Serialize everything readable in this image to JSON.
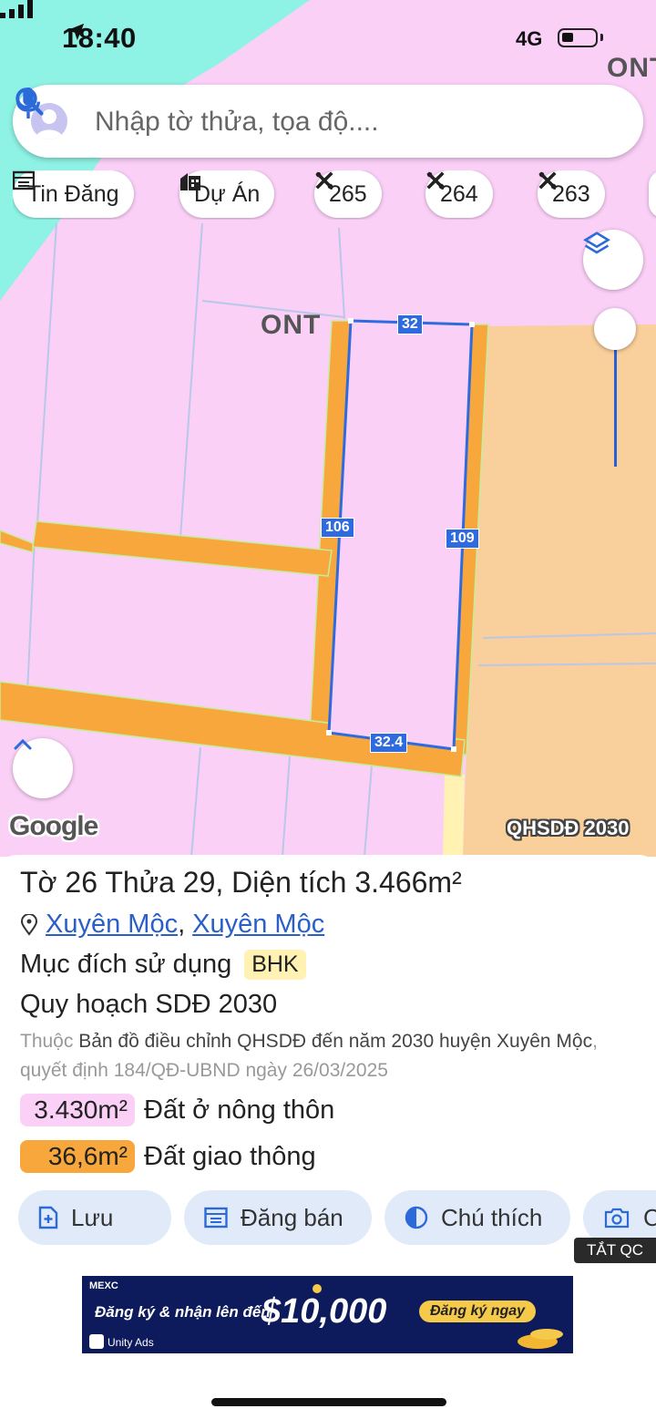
{
  "status": {
    "time": "18:40",
    "network": "4G"
  },
  "search": {
    "placeholder": "Nhập tờ thửa, tọa độ...."
  },
  "chips": [
    {
      "label": "Tin Đăng",
      "icon": "listing-icon"
    },
    {
      "label": "Dự Án",
      "icon": "building-icon"
    },
    {
      "label": "265",
      "icon": "tools-icon"
    },
    {
      "label": "264",
      "icon": "tools-icon"
    },
    {
      "label": "263",
      "icon": "tools-icon"
    }
  ],
  "map": {
    "zone_labels": [
      "ONT",
      "ONT"
    ],
    "edge_labels": [
      "32",
      "106",
      "109",
      "32.4"
    ],
    "google": "Google",
    "plan_tag": "QHSDĐ 2030",
    "colors": {
      "residential": "#fbd0f7",
      "road": "#f7a73b",
      "agri": "#f9cf9c",
      "water": "#8ef2e4",
      "boundary": "#2f6be0"
    }
  },
  "parcel": {
    "title_prefix1": "Tờ",
    "sheet_no": "26",
    "title_prefix2": "Thửa",
    "parcel_no": "29",
    "title_area": ", Diện tích",
    "area_value": "3.466m²",
    "commune": "Xuyên Mộc",
    "district": "Xuyên Mộc",
    "addr_sep": ",",
    "purpose_label": "Mục đích sử dụng",
    "purpose_code": "BHK",
    "plan_label": "Quy hoạch SDĐ 2030",
    "desc_prefix": "Thuộc",
    "desc_doc": "Bản đồ điều chỉnh QHSDĐ đến năm 2030 huyện Xuyên Mộc",
    "desc_suffix": ", quyết định 184/QĐ-UBND ngày 26/03/2025",
    "land_uses": [
      {
        "area": "3.430m²",
        "label": "Đất ở nông thôn",
        "color": "#fbd0f7"
      },
      {
        "area": "36,6m²",
        "label": "Đất giao thông",
        "color": "#f7a73b"
      }
    ]
  },
  "actions": [
    {
      "label": "Lưu",
      "icon": "save-icon"
    },
    {
      "label": "Đăng bán",
      "icon": "calendar-icon"
    },
    {
      "label": "Chú thích",
      "icon": "legend-icon"
    },
    {
      "label": "C",
      "icon": "camera-icon"
    }
  ],
  "ad": {
    "close_label": "TẮT QC",
    "brand": "MEXC",
    "headline": "Đăng ký & nhận lên đến",
    "amount": "$10,000",
    "cta": "Đăng ký ngay",
    "network": "Unity Ads"
  }
}
